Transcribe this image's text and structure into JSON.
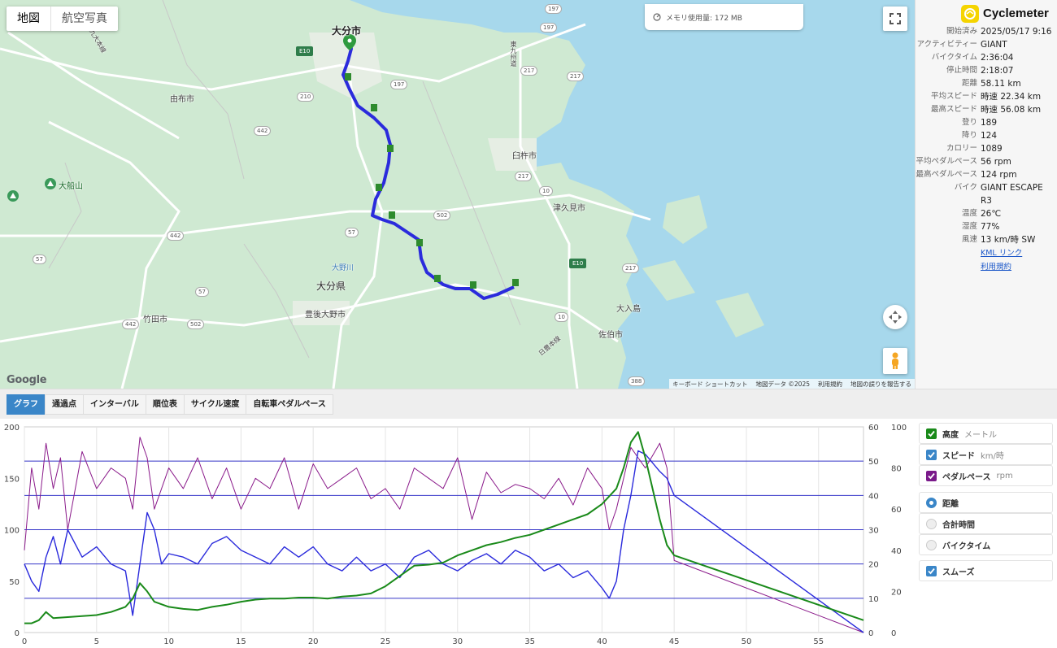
{
  "map": {
    "type_tabs": [
      "地図",
      "航空写真"
    ],
    "memory": "メモリ使用量: 172 MB",
    "labels": {
      "oita_city": "大分市",
      "yufu": "由布市",
      "usuki": "臼杵市",
      "tsukumi": "津久見市",
      "oita_pref": "大分県",
      "bungo_ono": "豊後大野市",
      "taketa": "竹田市",
      "saiki": "佐伯市",
      "oirijima": "大入島",
      "taisenzan": "大船山",
      "oitariver": "大野川",
      "higashikyushu": "東九州道",
      "nippo1": "日豊本線",
      "nippo2": "日豊本線",
      "kyudai": "九大本線"
    },
    "roads": [
      "197",
      "197",
      "217",
      "210",
      "442",
      "442",
      "57",
      "57",
      "502",
      "502",
      "10",
      "217",
      "E10",
      "E10",
      "388",
      "10",
      "197",
      "217",
      "217",
      "442",
      "57"
    ],
    "google": "Google",
    "footer": [
      "キーボード ショートカット",
      "地図データ ©2025",
      "利用規約",
      "地図の誤りを報告する"
    ]
  },
  "side": {
    "brand": "Cyclemeter",
    "stats": [
      {
        "k": "開始済み",
        "v": "2025/05/17 9:16"
      },
      {
        "k": "アクティビティー",
        "v": "GIANT"
      },
      {
        "k": "バイクタイム",
        "v": "2:36:04"
      },
      {
        "k": "停止時間",
        "v": "2:18:07"
      },
      {
        "k": "距離",
        "v": "58.11 km"
      },
      {
        "k": "平均スピード",
        "v": "時速 22.34 km"
      },
      {
        "k": "最高スピード",
        "v": "時速 56.08 km"
      },
      {
        "k": "登り",
        "v": "189"
      },
      {
        "k": "降り",
        "v": "124"
      },
      {
        "k": "カロリー",
        "v": "1089"
      },
      {
        "k": "平均ペダルペース",
        "v": "56 rpm"
      },
      {
        "k": "最高ペダルペース",
        "v": "124 rpm"
      },
      {
        "k": "バイク",
        "v": "GIANT ESCAPE R3"
      },
      {
        "k": "温度",
        "v": "26℃"
      },
      {
        "k": "湿度",
        "v": "77%"
      },
      {
        "k": "風速",
        "v": "13 km/時 SW"
      }
    ],
    "kml_link": "KML リンク",
    "terms_link": "利用規約"
  },
  "tabs": [
    "グラフ",
    "通過点",
    "インターバル",
    "順位表",
    "サイクル速度",
    "自転車ペダルペース"
  ],
  "legend": {
    "series": [
      {
        "label": "高度",
        "unit": "メートル",
        "color": "#1a8a1a"
      },
      {
        "label": "スピード",
        "unit": "km/時",
        "color": "#3a86c8"
      },
      {
        "label": "ペダルペース",
        "unit": "rpm",
        "color": "#7a1a8a"
      }
    ],
    "modes": [
      "距離",
      "合計時間",
      "バイクタイム"
    ],
    "smooth": "スムーズ"
  },
  "chart_data": {
    "type": "line",
    "x_axis": {
      "ticks": [
        0,
        5,
        10,
        15,
        20,
        25,
        30,
        35,
        40,
        45,
        50,
        55
      ],
      "range": [
        0,
        58.11
      ]
    },
    "y_left": {
      "ticks": [
        0,
        50,
        100,
        150,
        200
      ],
      "range": [
        0,
        200
      ]
    },
    "y_right_speed": {
      "ticks": [
        0,
        10,
        20,
        30,
        40,
        50,
        60
      ],
      "range": [
        0,
        60
      ]
    },
    "y_right_cadence": {
      "ticks": [
        0,
        20,
        40,
        60,
        80,
        100
      ],
      "range": [
        0,
        100
      ]
    },
    "grid": true,
    "series": [
      {
        "name": "高度",
        "color": "#1a8a1a",
        "axis": "left",
        "x": [
          0,
          0.5,
          1,
          1.5,
          2,
          3,
          4,
          5,
          6,
          7,
          7.5,
          8,
          8.5,
          9,
          10,
          11,
          12,
          13,
          14,
          15,
          16,
          17,
          18,
          19,
          20,
          21,
          22,
          23,
          24,
          25,
          26,
          27,
          28,
          29,
          30,
          31,
          32,
          33,
          34,
          35,
          36,
          37,
          38,
          39,
          40,
          41,
          41.5,
          42,
          42.5,
          43,
          44,
          44.5,
          45,
          58.11
        ],
        "y": [
          9,
          9,
          12,
          20,
          14,
          15,
          16,
          17,
          20,
          25,
          33,
          48,
          40,
          30,
          25,
          23,
          22,
          25,
          27,
          30,
          32,
          33,
          33,
          34,
          34,
          33,
          35,
          36,
          38,
          45,
          55,
          65,
          66,
          68,
          75,
          80,
          85,
          88,
          92,
          95,
          100,
          105,
          110,
          115,
          125,
          140,
          160,
          185,
          195,
          170,
          110,
          85,
          75,
          12
        ]
      },
      {
        "name": "スピード",
        "color": "#2a2adc",
        "axis": "right_speed",
        "x": [
          0,
          0.5,
          1,
          1.5,
          2,
          2.5,
          3,
          4,
          5,
          6,
          7,
          7.5,
          8,
          8.5,
          9,
          9.5,
          10,
          11,
          12,
          13,
          14,
          15,
          16,
          17,
          18,
          19,
          20,
          21,
          22,
          23,
          24,
          25,
          26,
          27,
          28,
          29,
          30,
          31,
          32,
          33,
          34,
          35,
          36,
          37,
          38,
          39,
          40,
          40.5,
          41,
          41.5,
          42,
          42.5,
          43,
          44,
          44.5,
          45,
          58.11
        ],
        "y": [
          20,
          15,
          12,
          22,
          28,
          20,
          30,
          22,
          25,
          20,
          18,
          5,
          20,
          35,
          30,
          20,
          23,
          22,
          20,
          26,
          28,
          24,
          22,
          20,
          25,
          22,
          25,
          20,
          18,
          22,
          18,
          20,
          16,
          22,
          24,
          20,
          18,
          21,
          23,
          20,
          24,
          22,
          18,
          20,
          16,
          18,
          13,
          10,
          15,
          30,
          40,
          53,
          52,
          47,
          45,
          40,
          0
        ]
      },
      {
        "name": "ペダルペース",
        "color": "#8a1a8a",
        "axis": "right_cadence",
        "x": [
          0,
          0.5,
          1,
          1.5,
          2,
          2.5,
          3,
          4,
          5,
          6,
          7,
          7.5,
          8,
          8.5,
          9,
          9.5,
          10,
          11,
          12,
          13,
          14,
          15,
          16,
          17,
          18,
          19,
          20,
          21,
          22,
          23,
          24,
          25,
          26,
          27,
          28,
          29,
          30,
          31,
          32,
          33,
          34,
          35,
          36,
          37,
          38,
          39,
          40,
          40.5,
          41,
          41.5,
          42,
          42.5,
          43,
          44,
          44.5,
          45,
          58.11
        ],
        "y": [
          40,
          80,
          60,
          92,
          70,
          85,
          50,
          88,
          70,
          80,
          75,
          60,
          95,
          85,
          60,
          70,
          80,
          70,
          85,
          65,
          80,
          60,
          75,
          70,
          85,
          60,
          82,
          70,
          75,
          80,
          65,
          70,
          60,
          80,
          75,
          70,
          85,
          55,
          78,
          68,
          72,
          70,
          65,
          75,
          62,
          80,
          70,
          50,
          60,
          75,
          90,
          85,
          80,
          92,
          80,
          35,
          0
        ]
      }
    ]
  }
}
